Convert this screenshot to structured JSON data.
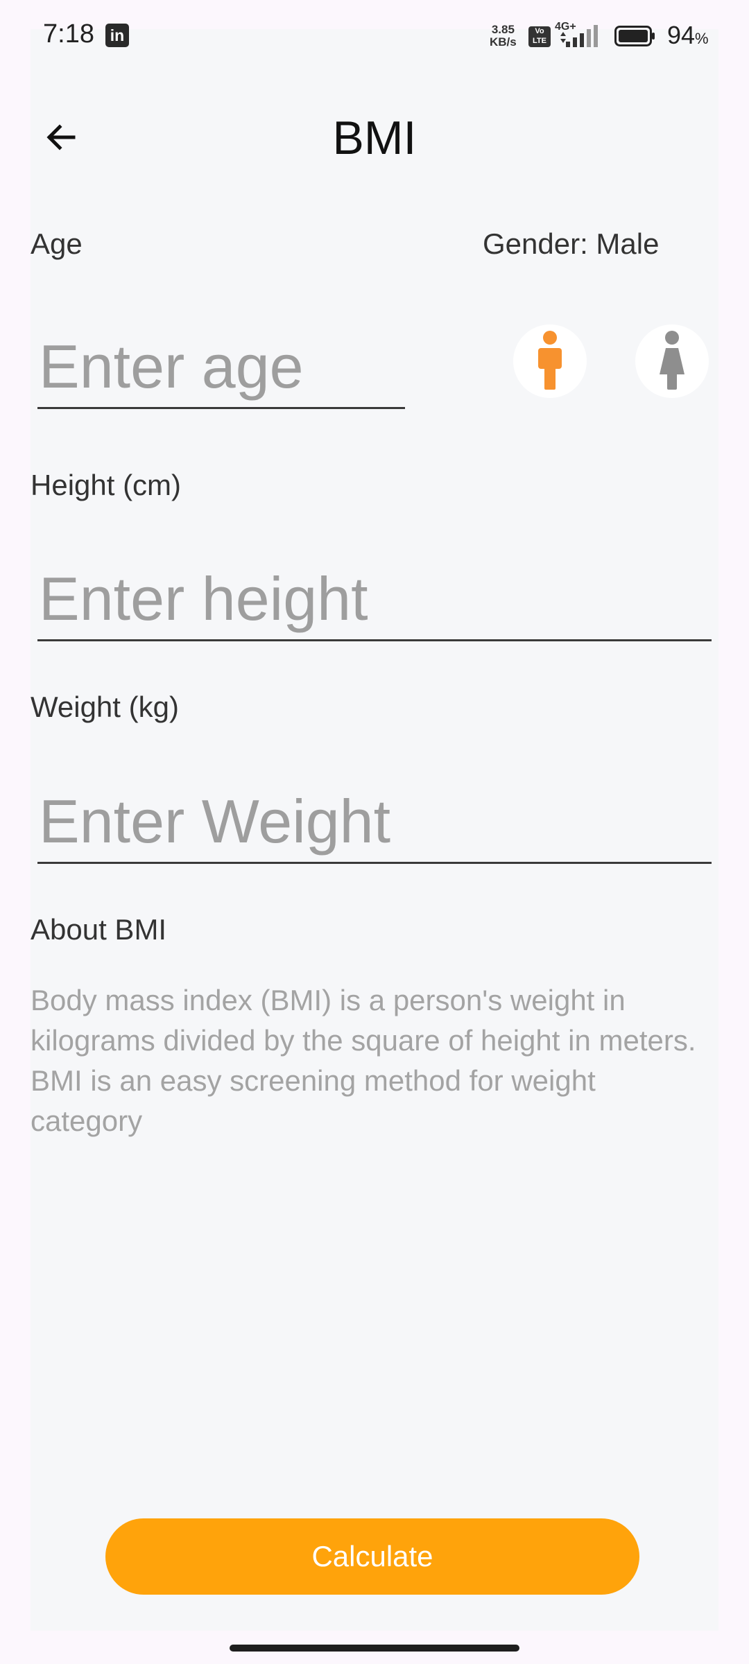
{
  "status_bar": {
    "time": "7:18",
    "notification_icon": "linkedin-icon",
    "notification_glyph": "in",
    "net_speed_value": "3.85",
    "net_speed_unit": "KB/s",
    "volte_top": "Vo",
    "volte_bottom": "LTE",
    "network_type": "4G+",
    "battery_percent": "94",
    "battery_unit": "%"
  },
  "app_bar": {
    "title": "BMI",
    "back_icon": "arrow-left-icon"
  },
  "form": {
    "age_label": "Age",
    "age_placeholder": "Enter age",
    "age_value": "",
    "gender_label": "Gender: Male",
    "gender_selected": "male",
    "male_icon": "male-person-icon",
    "female_icon": "female-person-icon",
    "height_label": "Height (cm)",
    "height_placeholder": "Enter height",
    "height_value": "",
    "weight_label": "Weight (kg)",
    "weight_placeholder": "Enter Weight",
    "weight_value": ""
  },
  "about": {
    "heading": "About BMI",
    "text": "Body mass index (BMI) is a person's weight in kilograms divided by the square of height in meters. BMI is an easy screening method for weight category"
  },
  "actions": {
    "calculate_label": "Calculate"
  },
  "colors": {
    "accent": "#ffa30b",
    "male_selected": "#f7922f",
    "female_unselected": "#8e8e8e",
    "background": "#f6f7f9",
    "placeholder": "#9e9e9e"
  }
}
